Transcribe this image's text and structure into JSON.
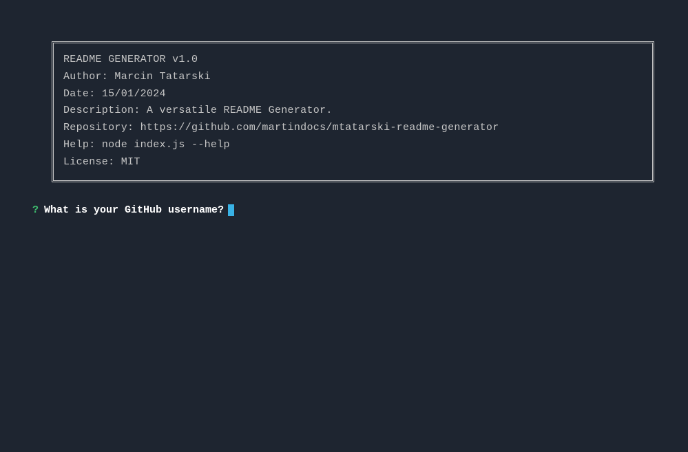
{
  "header": {
    "title": "README GENERATOR v1.0",
    "author_label": "Author: ",
    "author": "Marcin Tatarski",
    "date_label": "Date: ",
    "date": "15/01/2024",
    "description_label": "Description: ",
    "description": "A versatile README Generator.",
    "repository_label": "Repository: ",
    "repository": "https://github.com/martindocs/mtatarski-readme-generator",
    "help_label": "Help: ",
    "help": "node index.js --help",
    "license_label": "License: ",
    "license": "MIT"
  },
  "prompt": {
    "mark": "?",
    "question": "What is your GitHub username?",
    "input_value": ""
  }
}
